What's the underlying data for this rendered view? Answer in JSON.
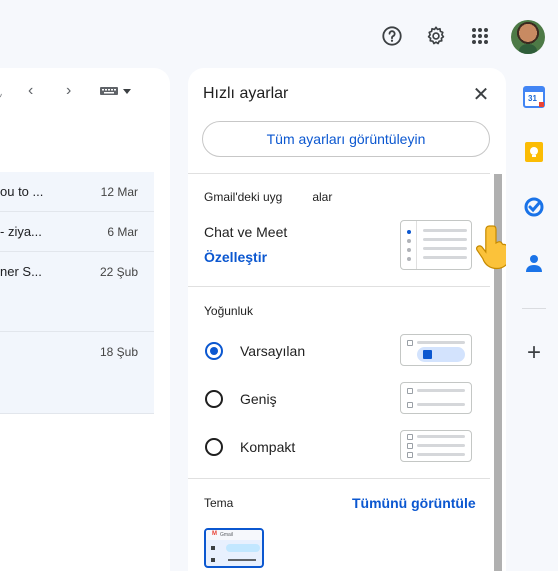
{
  "topbar": {
    "icons": [
      "help-icon",
      "settings-gear-icon",
      "apps-grid-icon",
      "account-avatar"
    ]
  },
  "mail": {
    "rows": [
      {
        "snippet": "ou to ...",
        "date": "12 Mar"
      },
      {
        "snippet": "- ziya...",
        "date": "6 Mar"
      },
      {
        "snippet": "ner S...",
        "date": "22 Şub"
      },
      {
        "snippet": "",
        "date": "18 Şub"
      }
    ]
  },
  "quick_settings": {
    "title": "Hızlı ayarlar",
    "close_symbol": "✕",
    "all_settings_label": "Tüm ayarları görüntüleyin",
    "apps_section": {
      "label": "Gmail'deki uyg",
      "label_suffix": "alar",
      "item": "Chat ve Meet",
      "customize_link": "Özelleştir"
    },
    "density": {
      "label": "Yoğunluk",
      "options": [
        {
          "label": "Varsayılan",
          "selected": true
        },
        {
          "label": "Geniş",
          "selected": false
        },
        {
          "label": "Kompakt",
          "selected": false
        }
      ]
    },
    "theme": {
      "label": "Tema",
      "view_all_link": "Tümünü görüntüle",
      "thumb_app_name": "Gmail"
    }
  },
  "side_panel": {
    "apps": [
      "calendar-icon",
      "keep-icon",
      "tasks-icon",
      "contacts-icon"
    ],
    "calendar_day": "31",
    "add_symbol": "+"
  },
  "colors": {
    "accent": "#0b57d0",
    "background": "#f6f8fc"
  }
}
